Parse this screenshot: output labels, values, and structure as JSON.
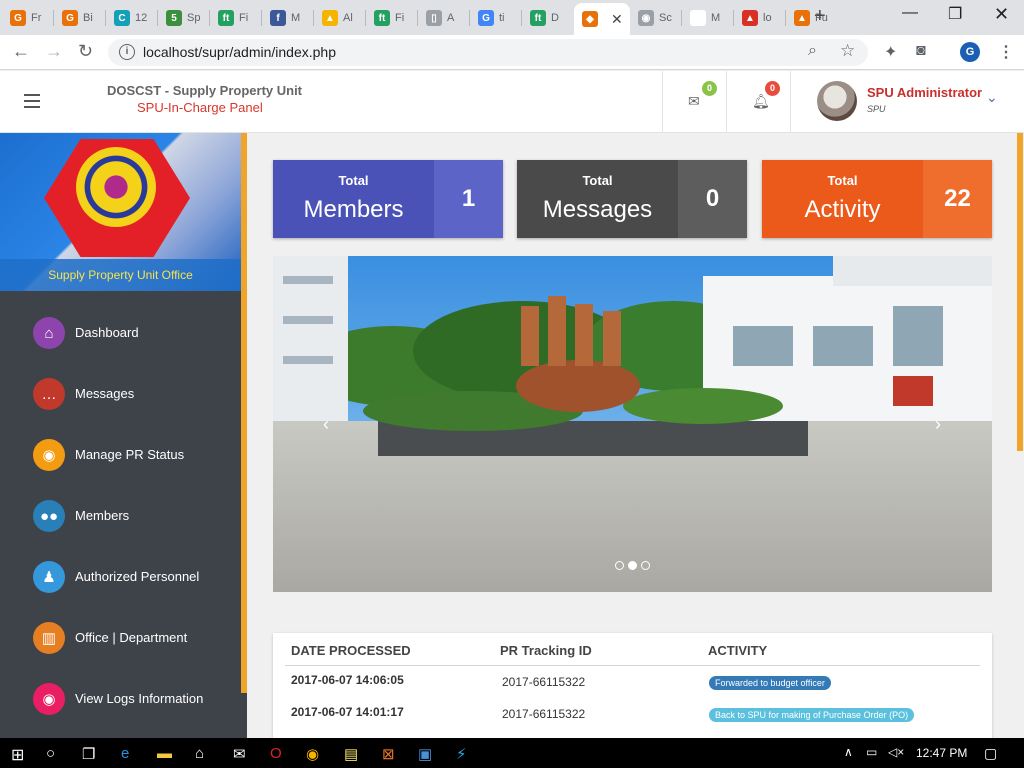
{
  "browser": {
    "tabs": [
      {
        "label": "Fr",
        "color": "#e8710a",
        "glyph": "G"
      },
      {
        "label": "Bi",
        "color": "#e8710a",
        "glyph": "G"
      },
      {
        "label": "12",
        "color": "#14a1b8",
        "glyph": "C"
      },
      {
        "label": "Sp",
        "color": "#3c8f3c",
        "glyph": "5"
      },
      {
        "label": "Fi",
        "color": "#24a162",
        "glyph": "ft"
      },
      {
        "label": "M",
        "color": "#3b5998",
        "glyph": "f"
      },
      {
        "label": "Al",
        "color": "#f4b400",
        "glyph": "▲"
      },
      {
        "label": "Fi",
        "color": "#24a162",
        "glyph": "ft"
      },
      {
        "label": "A",
        "color": "#9aa0a6",
        "glyph": "▯"
      },
      {
        "label": "ti",
        "color": "#4285f4",
        "glyph": "G"
      },
      {
        "label": "D",
        "color": "#24a162",
        "glyph": "ft"
      },
      {
        "label": "",
        "color": "#e8710a",
        "glyph": "◆",
        "active": true
      },
      {
        "label": "Sc",
        "color": "#9aa0a6",
        "glyph": "◉"
      },
      {
        "label": "M",
        "color": "#ffffff",
        "glyph": ""
      },
      {
        "label": "lo",
        "color": "#d93025",
        "glyph": "▲"
      },
      {
        "label": "Fu",
        "color": "#e8710a",
        "glyph": "▲"
      }
    ],
    "url": "localhost/supr/admin/index.php",
    "profile_initial": "G"
  },
  "header": {
    "title": "DOSCST - Supply Property Unit",
    "subtitle": "SPU-In-Charge Panel",
    "mail_count": "0",
    "notif_count": "0",
    "user_name": "SPU Administrator",
    "user_role": "SPU"
  },
  "sidebar": {
    "office_label": "Supply Property Unit Office",
    "items": [
      {
        "label": "Dashboard",
        "icon": "home-icon",
        "color": "#8e44ad"
      },
      {
        "label": "Messages",
        "icon": "chat-bubble-icon",
        "color": "#c0392b"
      },
      {
        "label": "Manage PR Status",
        "icon": "status-dial-icon",
        "color": "#f39c12"
      },
      {
        "label": "Members",
        "icon": "users-group-icon",
        "color": "#2980b9"
      },
      {
        "label": "Authorized Personnel",
        "icon": "personnel-icon",
        "color": "#3498db"
      },
      {
        "label": "Office | Department",
        "icon": "building-icon",
        "color": "#e67e22"
      },
      {
        "label": "View Logs Information",
        "icon": "eye-icon",
        "color": "#e91e63"
      }
    ]
  },
  "stats": [
    {
      "caption": "Total",
      "label": "Members",
      "value": "1",
      "color_left": "#4a52b8",
      "color_right": "#5c64c8"
    },
    {
      "caption": "Total",
      "label": "Messages",
      "value": "0",
      "color_left": "#4a4a4a",
      "color_right": "#5d5d5d"
    },
    {
      "caption": "Total",
      "label": "Activity",
      "value": "22",
      "color_left": "#ec5a1b",
      "color_right": "#ef6e2d"
    }
  ],
  "carousel": {
    "prev": "‹",
    "next": "›",
    "active_slide": 2,
    "slide_count": 3
  },
  "table": {
    "headers": [
      "DATE PROCESSED",
      "PR Tracking ID",
      "ACTIVITY"
    ],
    "rows": [
      {
        "date": "2017-06-07 14:06:05",
        "id": "2017-66115322",
        "activity": "Forwarded to budget officer",
        "color": "#337ab7"
      },
      {
        "date": "2017-06-07 14:01:17",
        "id": "2017-66115322",
        "activity": "Back to SPU for making of Purchase Order (PO)",
        "color": "#5bc0de"
      }
    ]
  },
  "taskbar": {
    "time": "12:47 PM"
  }
}
